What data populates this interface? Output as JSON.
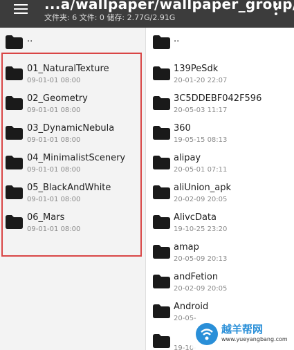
{
  "header": {
    "path": "...a/wallpaper/wallpaper_group/",
    "stats": "文件夹: 6   文件: 0   储存: 2.77G/2.91G"
  },
  "left_pane": {
    "parent_label": "..",
    "items": [
      {
        "name": "01_NaturalTexture",
        "date": "09-01-01 08:00"
      },
      {
        "name": "02_Geometry",
        "date": "09-01-01 08:00"
      },
      {
        "name": "03_DynamicNebula",
        "date": "09-01-01 08:00"
      },
      {
        "name": "04_MinimalistScenery",
        "date": "09-01-01 08:00"
      },
      {
        "name": "05_BlackAndWhite",
        "date": "09-01-01 08:00"
      },
      {
        "name": "06_Mars",
        "date": "09-01-01 08:00"
      }
    ]
  },
  "right_pane": {
    "parent_label": "..",
    "items": [
      {
        "name": "139PeSdk",
        "date": "20-01-20 22:07"
      },
      {
        "name": "3C5DDEBF042F596",
        "date": "20-05-03 11:17"
      },
      {
        "name": "360",
        "date": "19-05-15 08:13"
      },
      {
        "name": "alipay",
        "date": "20-05-01 07:11"
      },
      {
        "name": "aliUnion_apk",
        "date": "20-02-09 20:05"
      },
      {
        "name": "AlivcData",
        "date": "19-10-25 23:20"
      },
      {
        "name": "amap",
        "date": "20-05-09 20:13"
      },
      {
        "name": "andFetion",
        "date": "20-02-09 20:05"
      },
      {
        "name": "Android",
        "date": "20-05-"
      },
      {
        "name": "",
        "date": "19-10-"
      }
    ]
  },
  "watermark": {
    "text": "越羊帮网",
    "url": "www.yueyangbang.com"
  },
  "colors": {
    "appbar": "#3c3c3c",
    "left_pane_bg": "#f3f3f3",
    "highlight": "#d94545",
    "folder": "#1a1a1a"
  }
}
